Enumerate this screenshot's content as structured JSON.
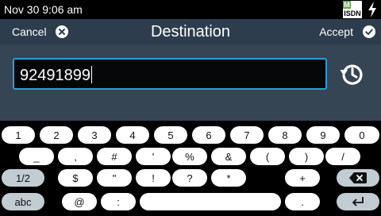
{
  "status": {
    "time": "Nov 30 9:06 am",
    "badge_letter": "M",
    "badge_label": "ISDN"
  },
  "header": {
    "cancel_label": "Cancel",
    "title": "Destination",
    "accept_label": "Accept"
  },
  "input": {
    "value": "92491899"
  },
  "icons": {
    "cancel": "close-circle-icon",
    "accept": "check-circle-icon",
    "history": "history-icon",
    "backspace": "backspace-icon",
    "enter": "enter-icon",
    "power": "lightning-bolt-icon"
  },
  "colors": {
    "header_bg": "#2e3d4d",
    "input_area_bg": "#364553",
    "input_border": "#2a9fd8",
    "key_bg": "#ffffff",
    "key_special_bg": "#c2ccd3"
  },
  "keyboard": {
    "row1": [
      "1",
      "2",
      "3",
      "4",
      "5",
      "6",
      "7",
      "8",
      "9",
      "0"
    ],
    "row2": [
      "_",
      ",",
      "#",
      "'",
      "%",
      "&",
      "(",
      ")",
      "/"
    ],
    "row3": [
      "1/2",
      "$",
      "\"",
      "!",
      "?",
      "*",
      "+"
    ],
    "row4": [
      "abc",
      "@",
      ":",
      "",
      "."
    ]
  }
}
